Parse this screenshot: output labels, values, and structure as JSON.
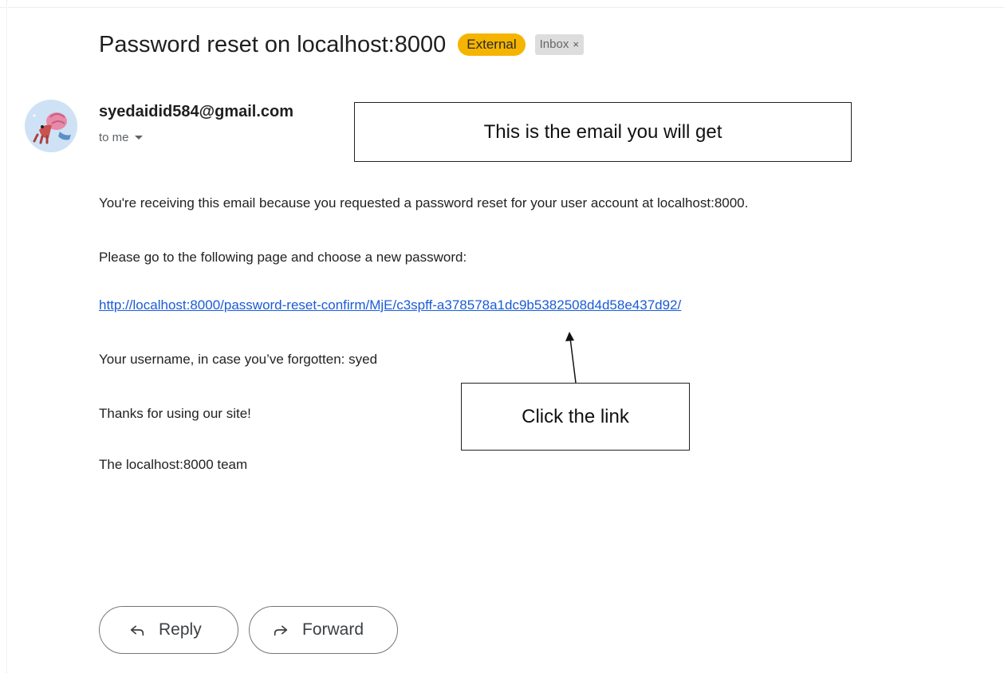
{
  "email": {
    "subject": "Password reset on localhost:8000",
    "labels": {
      "external": "External",
      "inbox": "Inbox",
      "inbox_remove": "×"
    },
    "sender": "syedaidid584@gmail.com",
    "recipient": "to me",
    "body": {
      "line_1": "You're receiving this email because you requested a password reset for your user account at localhost:8000.",
      "line_2": "Please go to the following page and choose a new password:",
      "reset_link": "http://localhost:8000/password-reset-confirm/MjE/c3spff-a378578a1dc9b5382508d4d58e437d92/",
      "username_line": "Your username, in case you’ve forgotten: syed",
      "thanks": "Thanks for using our site!",
      "signature": "The localhost:8000 team"
    }
  },
  "annotations": {
    "email_callout": "This is the email you will get",
    "link_callout": "Click the link"
  },
  "actions": {
    "reply_label": "Reply",
    "forward_label": "Forward"
  },
  "colors": {
    "external_badge": "#f5b400",
    "inbox_badge": "#dddddd",
    "link": "#1a5cd7",
    "avatar_bg": "#cfe2f5"
  },
  "icons": {
    "reply": "reply-icon",
    "forward": "forward-icon",
    "caret": "caret-down-icon",
    "avatar": "hermit-crab-avatar"
  }
}
